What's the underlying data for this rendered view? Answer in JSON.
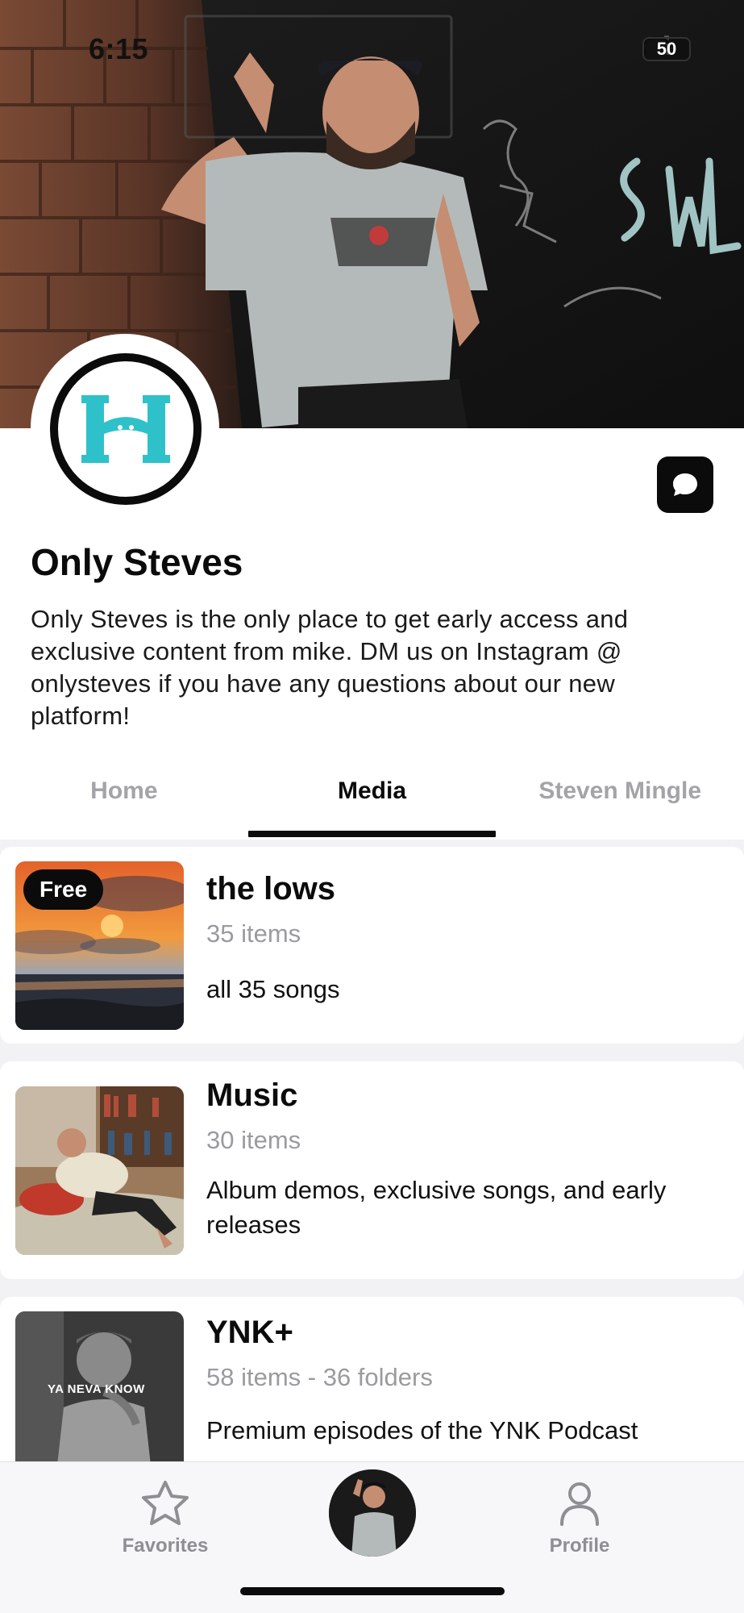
{
  "status_bar": {
    "time": "6:15",
    "battery": "50",
    "icons": [
      "signal-icon",
      "wifi-icon",
      "battery-icon"
    ]
  },
  "profile": {
    "avatar_icon": "creator-logo-icon",
    "message_icon": "chat-bubble-icon",
    "name": "Only Steves",
    "bio": "Only Steves is the only place to get early access and exclusive content from mike. DM us on Instagram @ onlysteves if you have any questions about our new platform!"
  },
  "tabs": [
    {
      "label": "Home",
      "active": false
    },
    {
      "label": "Media",
      "active": true
    },
    {
      "label": "Steven Mingle",
      "active": false
    }
  ],
  "media": [
    {
      "title": "the lows",
      "count": "35 items",
      "description": "all 35 songs",
      "badge": "Free"
    },
    {
      "title": "Music",
      "count": "30 items",
      "description": "Album demos, exclusive songs, and early releases"
    },
    {
      "title": "YNK+",
      "count": "58 items - 36 folders",
      "description": "Premium episodes of the YNK Podcast",
      "thumb_text": "YA NEVA KNOW"
    }
  ],
  "bottom_nav": {
    "favorites": {
      "label": "Favorites",
      "icon": "star-icon"
    },
    "center": {
      "icon": "avatar"
    },
    "profile": {
      "label": "Profile",
      "icon": "person-icon"
    }
  },
  "colors": {
    "accent": "#0b0b0b",
    "logo_teal": "#2fc1c9",
    "muted": "#9b9b9f"
  }
}
